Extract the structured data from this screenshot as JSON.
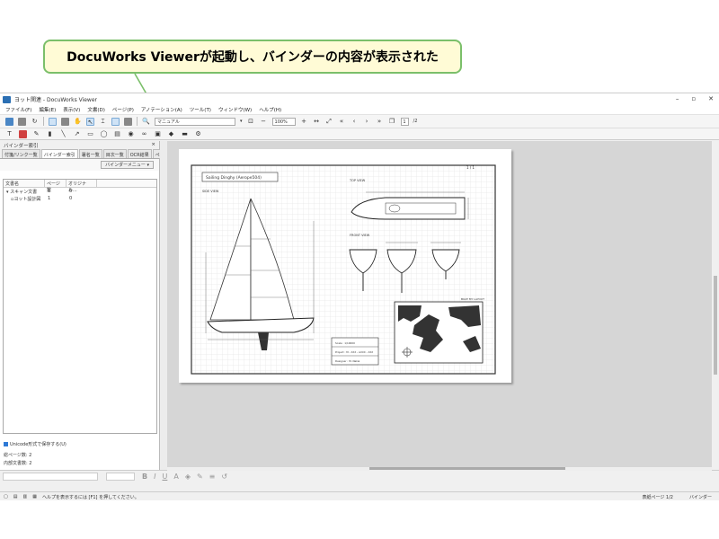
{
  "callout": {
    "text": "DocuWorks Viewerが起動し、バインダーの内容が表示された"
  },
  "window": {
    "title": "ヨット関連 - DocuWorks Viewer",
    "controls": [
      "–",
      "▫",
      "✕"
    ]
  },
  "menu": [
    "ファイル(F)",
    "編集(E)",
    "表示(V)",
    "文書(D)",
    "ページ(P)",
    "アノテーション(A)",
    "ツール(T)",
    "ウィンドウ(W)",
    "ヘルプ(H)"
  ],
  "toolbar": {
    "zoom_mode": "マニュアル",
    "zoom_percent": "100%",
    "page_current": "1",
    "page_total": "/2"
  },
  "panel": {
    "title": "バインダー索引",
    "tabs": [
      "付箋/リンク一覧",
      "バインダー索引",
      "署名一覧",
      "目次一覧",
      "OCR結果",
      "ページ属性"
    ],
    "menu_button": "バインダーメニュー",
    "columns": [
      "文書名",
      "ページ数",
      "オリジナル..."
    ],
    "rows": [
      {
        "name": "スキャン文書",
        "pages": "1",
        "original": "0"
      },
      {
        "name": "ヨット設計図",
        "pages": "1",
        "original": "0"
      }
    ],
    "unicode_option": "Unicode形式で保存する(U)",
    "total_pages": "総ページ数:  2",
    "internal_docs": "内部文書数: 2"
  },
  "drawing": {
    "title": "Sailing Dinghy (Aerope504)",
    "page_no": "1 / 1",
    "side_view_label": "SIDE VIEW",
    "top_view_label": "TOP VIEW",
    "front_view_label": "FRONT VIEW",
    "map_label": "BOAT MY LAYOUT",
    "info_lines": [
      "Scale : 1/10000",
      "Project : M - XXX - AXXX - XXX",
      "Designer : M. Nakai"
    ]
  },
  "status": {
    "help": "ヘルプを表示するには [F1] を押してください。",
    "page": "表紙ページ 1/2",
    "binder": "バインダー"
  }
}
